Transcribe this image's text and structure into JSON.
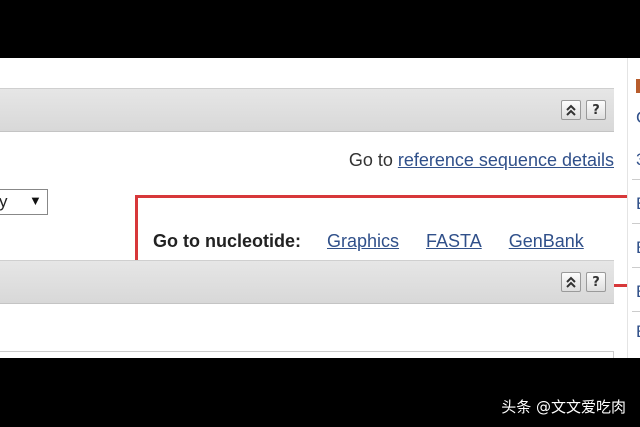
{
  "ref_goto": {
    "prefix": "Go to",
    "link": "reference sequence details"
  },
  "select": {
    "value": "y",
    "arrow": "▼"
  },
  "nucleotide": {
    "label": "Go to nucleotide:",
    "links": [
      "Graphics",
      "FASTA",
      "GenBank"
    ]
  },
  "header_buttons": {
    "help": "?"
  },
  "right_edge": {
    "items": [
      "C",
      "3",
      "E",
      "E",
      "E",
      "E"
    ]
  },
  "watermark": "头条 @文文爱吃肉",
  "colors": {
    "link": "#30508a",
    "highlight_border": "#d7383a",
    "header_bg": "#dcdcdc"
  }
}
